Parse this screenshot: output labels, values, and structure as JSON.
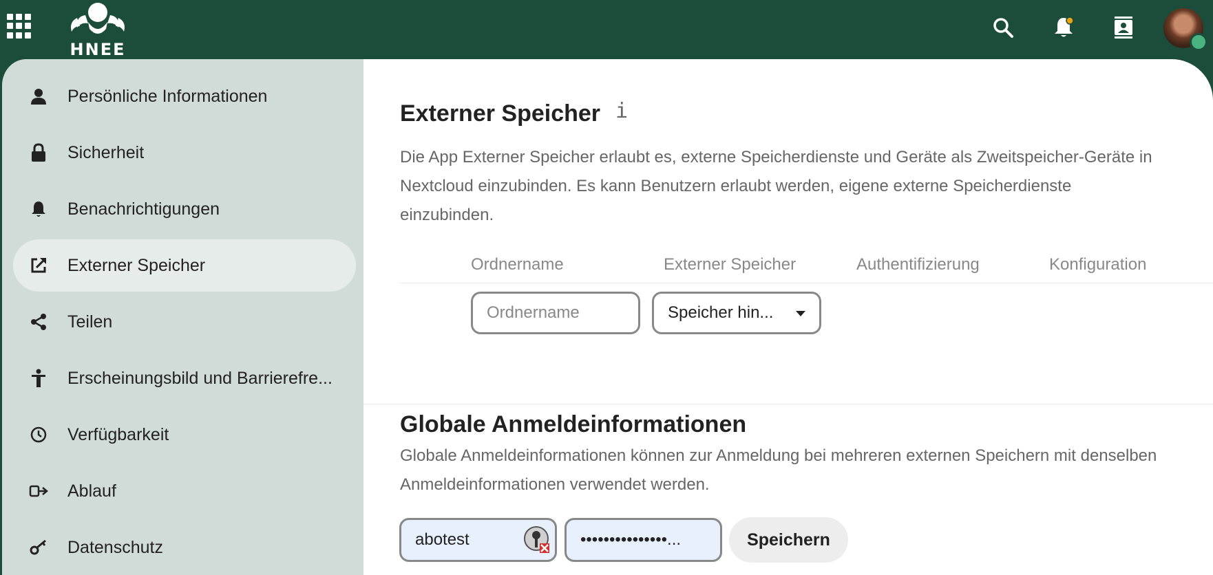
{
  "header": {
    "logo_text": "HNEE",
    "icons": [
      "app-menu-icon",
      "search-icon",
      "notifications-icon",
      "contacts-icon"
    ],
    "accent_color": "#1b4d3a",
    "status_color": "#49b382"
  },
  "sidebar": {
    "items": [
      {
        "label": "Persönliche Informationen",
        "icon": "person-icon"
      },
      {
        "label": "Sicherheit",
        "icon": "lock-icon"
      },
      {
        "label": "Benachrichtigungen",
        "icon": "bell-icon"
      },
      {
        "label": "Externer Speicher",
        "icon": "external-link-icon",
        "active": true
      },
      {
        "label": "Teilen",
        "icon": "share-icon"
      },
      {
        "label": "Erscheinungsbild und Barrierefre...",
        "icon": "accessibility-icon"
      },
      {
        "label": "Verfügbarkeit",
        "icon": "clock-icon"
      },
      {
        "label": "Ablauf",
        "icon": "flow-icon"
      },
      {
        "label": "Datenschutz",
        "icon": "key-icon"
      }
    ]
  },
  "external_storage": {
    "title": "Externer Speicher",
    "description": "Die App Externer Speicher erlaubt es, externe Speicherdienste und Geräte als Zweitspeicher-Geräte in Nextcloud einzubinden. Es kann Benutzern erlaubt werden, eigene externe Speicherdienste einzubinden.",
    "columns": [
      "Ordnername",
      "Externer Speicher",
      "Authentifizierung",
      "Konfiguration"
    ],
    "folder_placeholder": "Ordnername",
    "storage_select": "Speicher hin..."
  },
  "global_credentials": {
    "title": "Globale Anmeldeinformationen",
    "description": "Globale Anmeldeinformationen können zur Anmeldung bei mehreren externen Speichern mit denselben Anmeldeinformationen verwendet werden.",
    "username": "abotest",
    "password": "•••••••••••••••...",
    "save_label": "Speichern"
  }
}
